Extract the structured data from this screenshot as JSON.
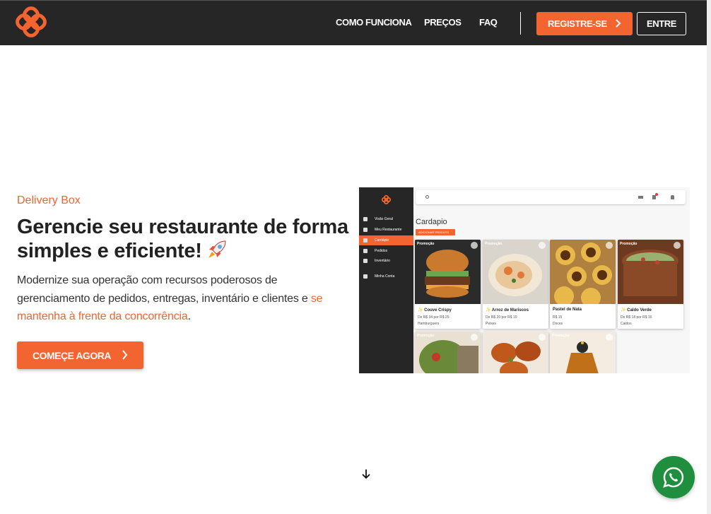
{
  "nav": {
    "links": [
      "COMO FUNCIONA",
      "PREÇOS",
      "FAQ"
    ],
    "register_label": "REGISTRE-SE",
    "login_label": "ENTRE"
  },
  "hero": {
    "eyebrow": "Delivery Box",
    "headline": "Gerencie seu restaurante de forma simples e eficiente!",
    "description": "Modernize sua operação com recursos poderosos de gerenciamento de pedidos, entregas, inventário e clientes e ",
    "description_highlight": "se mantenha à frente da concorrência",
    "description_end": ".",
    "cta_label": "COMEÇE AGORA"
  },
  "preview": {
    "sidebar": [
      "Visão Geral",
      "Meu Restaurante",
      "Cardápio",
      "Pedidos",
      "Inventário",
      "Minha Conta"
    ],
    "page_title": "Cardapio",
    "add_button": "ADICIONAR PRODUTO",
    "cards": [
      {
        "tag": "Promoção",
        "name": "✨ Couve Crispy",
        "price": "De R$ 34 por R$ 25",
        "category": "Hamburguers"
      },
      {
        "tag": "Promoção",
        "name": "✨ Arroz de Mariscos",
        "price": "De R$ 20 por R$ 19",
        "category": "Peixes"
      },
      {
        "tag": "",
        "name": "Pastel de Nata",
        "price": "R$ 15",
        "category": "Doces"
      },
      {
        "tag": "Promoção",
        "name": "✨ Caldo Verde",
        "price": "De R$ 18 por R$ 16",
        "category": "Caldos"
      },
      {
        "tag": "Promoção",
        "name": "",
        "price": "",
        "category": ""
      },
      {
        "tag": "",
        "name": "",
        "price": "",
        "category": ""
      },
      {
        "tag": "Promoção",
        "name": "",
        "price": "",
        "category": ""
      }
    ]
  },
  "colors": {
    "accent": "#f26430",
    "navbar": "#262626",
    "whatsapp": "#1f8f3f"
  },
  "icons": [
    "logo-icon",
    "chevron-right-icon",
    "rocket-icon",
    "arrow-down-icon",
    "whatsapp-icon"
  ]
}
